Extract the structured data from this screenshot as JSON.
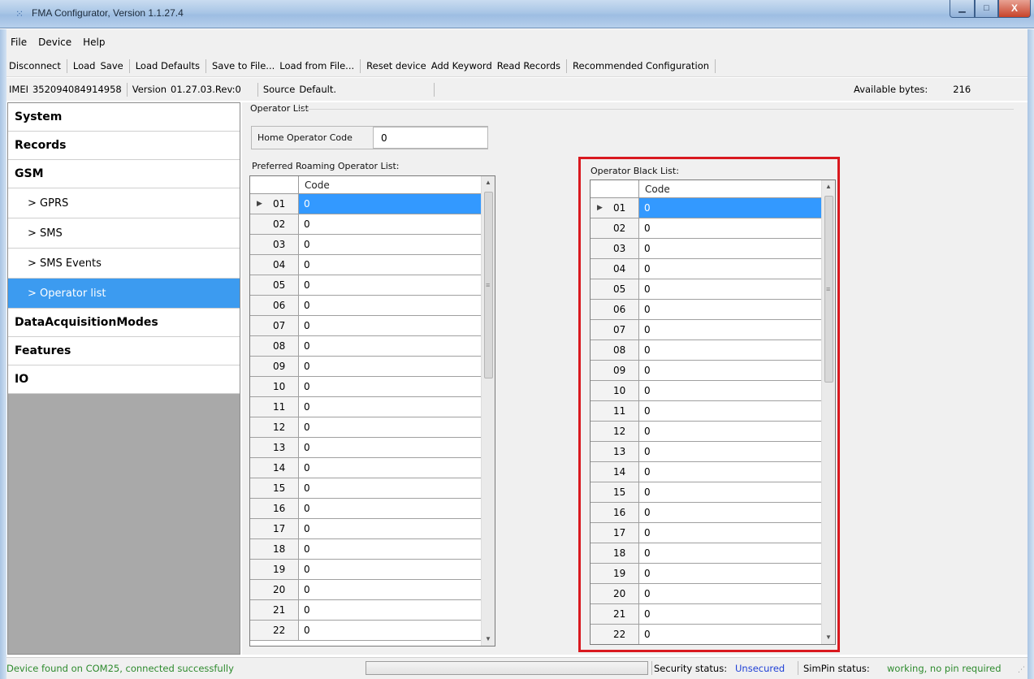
{
  "window": {
    "title": "FMA Configurator, Version 1.1.27.4",
    "app_icon": "app-grid-icon",
    "min_glyph": "▁",
    "max_glyph": "□",
    "close_glyph": "X"
  },
  "menu": [
    "File",
    "Device",
    "Help"
  ],
  "toolbar": {
    "groups": [
      [
        "Disconnect"
      ],
      [
        "Load",
        "Save"
      ],
      [
        "Load Defaults"
      ],
      [
        "Save to File...",
        "Load from File..."
      ],
      [
        "Reset device",
        "Add Keyword",
        "Read Records"
      ],
      [
        "Recommended Configuration"
      ]
    ]
  },
  "info": {
    "imei_label": "IMEI",
    "imei_value": "352094084914958",
    "version_label": "Version",
    "version_value": "01.27.03.Rev:0",
    "source_label": "Source",
    "source_value": "Default.",
    "available_label": "Available bytes:",
    "available_value": "216"
  },
  "sidebar": {
    "items": [
      {
        "label": "System",
        "level": "top",
        "active": false
      },
      {
        "label": "Records",
        "level": "top",
        "active": false
      },
      {
        "label": "GSM",
        "level": "top",
        "active": false
      },
      {
        "label": "> GPRS",
        "level": "sub",
        "active": false
      },
      {
        "label": "> SMS",
        "level": "sub",
        "active": false
      },
      {
        "label": "> SMS Events",
        "level": "sub",
        "active": false
      },
      {
        "label": "> Operator list",
        "level": "sub",
        "active": true
      },
      {
        "label": "DataAcquisitionModes",
        "level": "top",
        "active": false
      },
      {
        "label": "Features",
        "level": "top",
        "active": false
      },
      {
        "label": "IO",
        "level": "top",
        "active": false
      }
    ]
  },
  "operator": {
    "section_title": "Operator List",
    "home_label": "Home Operator Code",
    "home_value": "0",
    "roaming_title": "Preferred Roaming Operator List:",
    "black_title": "Operator Black List:",
    "column_header": "Code",
    "roaming_rows": [
      {
        "n": "01",
        "v": "0"
      },
      {
        "n": "02",
        "v": "0"
      },
      {
        "n": "03",
        "v": "0"
      },
      {
        "n": "04",
        "v": "0"
      },
      {
        "n": "05",
        "v": "0"
      },
      {
        "n": "06",
        "v": "0"
      },
      {
        "n": "07",
        "v": "0"
      },
      {
        "n": "08",
        "v": "0"
      },
      {
        "n": "09",
        "v": "0"
      },
      {
        "n": "10",
        "v": "0"
      },
      {
        "n": "11",
        "v": "0"
      },
      {
        "n": "12",
        "v": "0"
      },
      {
        "n": "13",
        "v": "0"
      },
      {
        "n": "14",
        "v": "0"
      },
      {
        "n": "15",
        "v": "0"
      },
      {
        "n": "16",
        "v": "0"
      },
      {
        "n": "17",
        "v": "0"
      },
      {
        "n": "18",
        "v": "0"
      },
      {
        "n": "19",
        "v": "0"
      },
      {
        "n": "20",
        "v": "0"
      },
      {
        "n": "21",
        "v": "0"
      },
      {
        "n": "22",
        "v": "0"
      }
    ],
    "black_rows": [
      {
        "n": "01",
        "v": "0"
      },
      {
        "n": "02",
        "v": "0"
      },
      {
        "n": "03",
        "v": "0"
      },
      {
        "n": "04",
        "v": "0"
      },
      {
        "n": "05",
        "v": "0"
      },
      {
        "n": "06",
        "v": "0"
      },
      {
        "n": "07",
        "v": "0"
      },
      {
        "n": "08",
        "v": "0"
      },
      {
        "n": "09",
        "v": "0"
      },
      {
        "n": "10",
        "v": "0"
      },
      {
        "n": "11",
        "v": "0"
      },
      {
        "n": "12",
        "v": "0"
      },
      {
        "n": "13",
        "v": "0"
      },
      {
        "n": "14",
        "v": "0"
      },
      {
        "n": "15",
        "v": "0"
      },
      {
        "n": "16",
        "v": "0"
      },
      {
        "n": "17",
        "v": "0"
      },
      {
        "n": "18",
        "v": "0"
      },
      {
        "n": "19",
        "v": "0"
      },
      {
        "n": "20",
        "v": "0"
      },
      {
        "n": "21",
        "v": "0"
      },
      {
        "n": "22",
        "v": "0"
      }
    ],
    "selected_row": "01",
    "highlight_color": "#d9191f"
  },
  "status": {
    "message": "Device found on COM25, connected successfully",
    "security_label": "Security status:",
    "security_value": "Unsecured",
    "simpin_label": "SimPin status:",
    "simpin_value": "working, no pin required"
  },
  "colors": {
    "selection": "#3399ff",
    "sidebar_active": "#3c9bf0",
    "status_ok": "#2e8b2e",
    "status_link": "#1e3fd6"
  }
}
